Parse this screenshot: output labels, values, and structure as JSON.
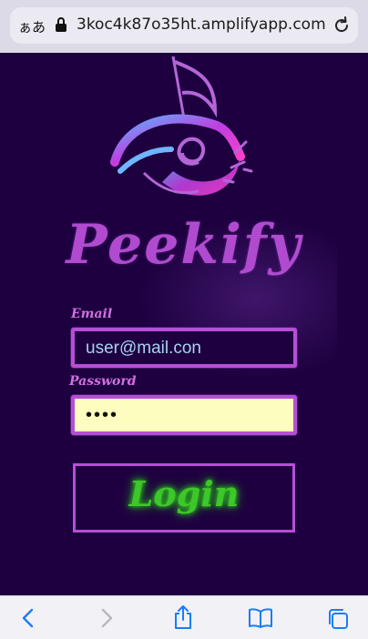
{
  "browser": {
    "text_size_label": "ぁあ",
    "url": "3koc4k87o35ht.amplifyapp.com"
  },
  "app": {
    "brand": "Peekify",
    "email_label": "Email",
    "email_value": "user@mail.con",
    "password_label": "Password",
    "password_value": "••••",
    "login_label": "Login"
  },
  "toolbar": {
    "icons": [
      "back-icon",
      "forward-icon",
      "share-icon",
      "bookmarks-icon",
      "tabs-icon"
    ]
  },
  "colors": {
    "background": "#1e0040",
    "accent": "#b64fd6",
    "login_text": "#3ec72a",
    "password_bg": "#fdfdbf"
  }
}
